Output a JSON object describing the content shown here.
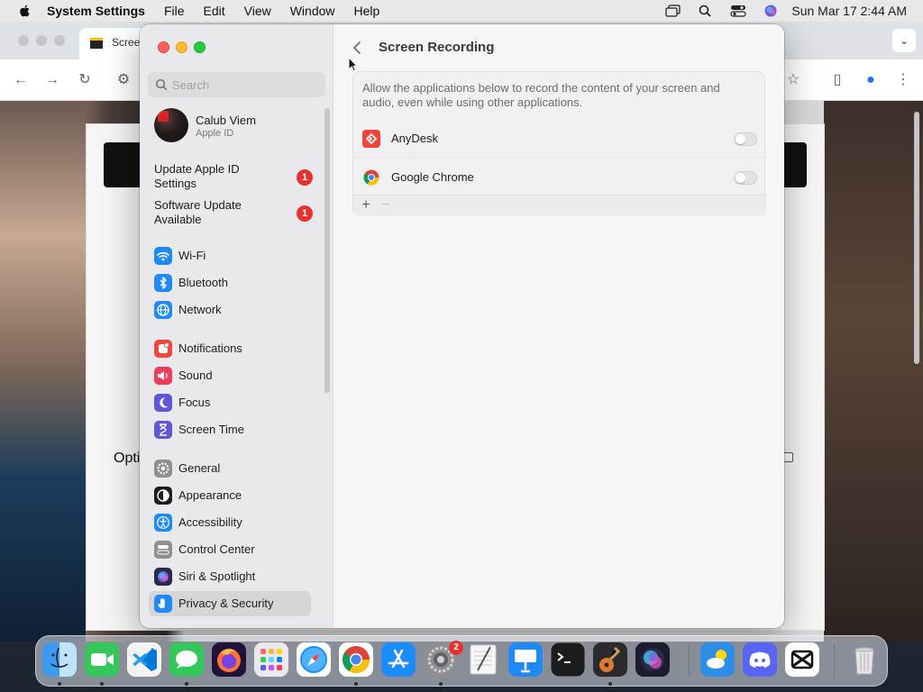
{
  "menubar": {
    "app_name": "System Settings",
    "menus": [
      "File",
      "Edit",
      "View",
      "Window",
      "Help"
    ],
    "clock": "Sun Mar 17  2:44 AM"
  },
  "browser_background": {
    "tab_title": "Scree",
    "page_text_fragment": "Opti"
  },
  "sidebar": {
    "search_placeholder": "Search",
    "profile": {
      "name": "Calub Viem",
      "subtitle": "Apple ID"
    },
    "notices": [
      {
        "label": "Update Apple ID Settings",
        "badge": "1"
      },
      {
        "label": "Software Update Available",
        "badge": "1"
      }
    ],
    "items": [
      {
        "label": "Wi-Fi",
        "icon": "wifi-icon",
        "color": "#1f8af5"
      },
      {
        "label": "Bluetooth",
        "icon": "bluetooth-icon",
        "color": "#1f8af5"
      },
      {
        "label": "Network",
        "icon": "globe-icon",
        "color": "#1f8af5"
      },
      {
        "label": "Notifications",
        "icon": "bell-icon",
        "color": "#f0473d"
      },
      {
        "label": "Sound",
        "icon": "speaker-icon",
        "color": "#ef3b5c"
      },
      {
        "label": "Focus",
        "icon": "moon-icon",
        "color": "#5e57d6"
      },
      {
        "label": "Screen Time",
        "icon": "hourglass-icon",
        "color": "#5e57d6"
      },
      {
        "label": "General",
        "icon": "gear-icon",
        "color": "#8e8e93"
      },
      {
        "label": "Appearance",
        "icon": "appearance-icon",
        "color": "#1d1d1f"
      },
      {
        "label": "Accessibility",
        "icon": "accessibility-icon",
        "color": "#1f8af5"
      },
      {
        "label": "Control Center",
        "icon": "control-center-icon",
        "color": "#8e8e93"
      },
      {
        "label": "Siri & Spotlight",
        "icon": "siri-icon",
        "color": "#2a2a48"
      },
      {
        "label": "Privacy & Security",
        "icon": "hand-icon",
        "color": "#1f8af5"
      }
    ]
  },
  "main": {
    "title": "Screen Recording",
    "description": "Allow the applications below to record the content of your screen and audio, even while using other applications.",
    "apps": [
      {
        "name": "AnyDesk",
        "icon": "anydesk-icon",
        "enabled": false
      },
      {
        "name": "Google Chrome",
        "icon": "chrome-icon",
        "enabled": false
      }
    ],
    "add_label": "+",
    "remove_label": "−"
  },
  "dock": {
    "apps": [
      "Finder",
      "FaceTime",
      "Visual Studio Code",
      "Messages",
      "Firefox",
      "Launchpad",
      "Safari",
      "Google Chrome",
      "App Store",
      "System Settings",
      "TextEdit",
      "Keynote",
      "Terminal",
      "GarageBand",
      "Siri",
      "Weather",
      "Discord",
      "CapCut",
      "Trash"
    ],
    "system_settings_badge": "2"
  }
}
